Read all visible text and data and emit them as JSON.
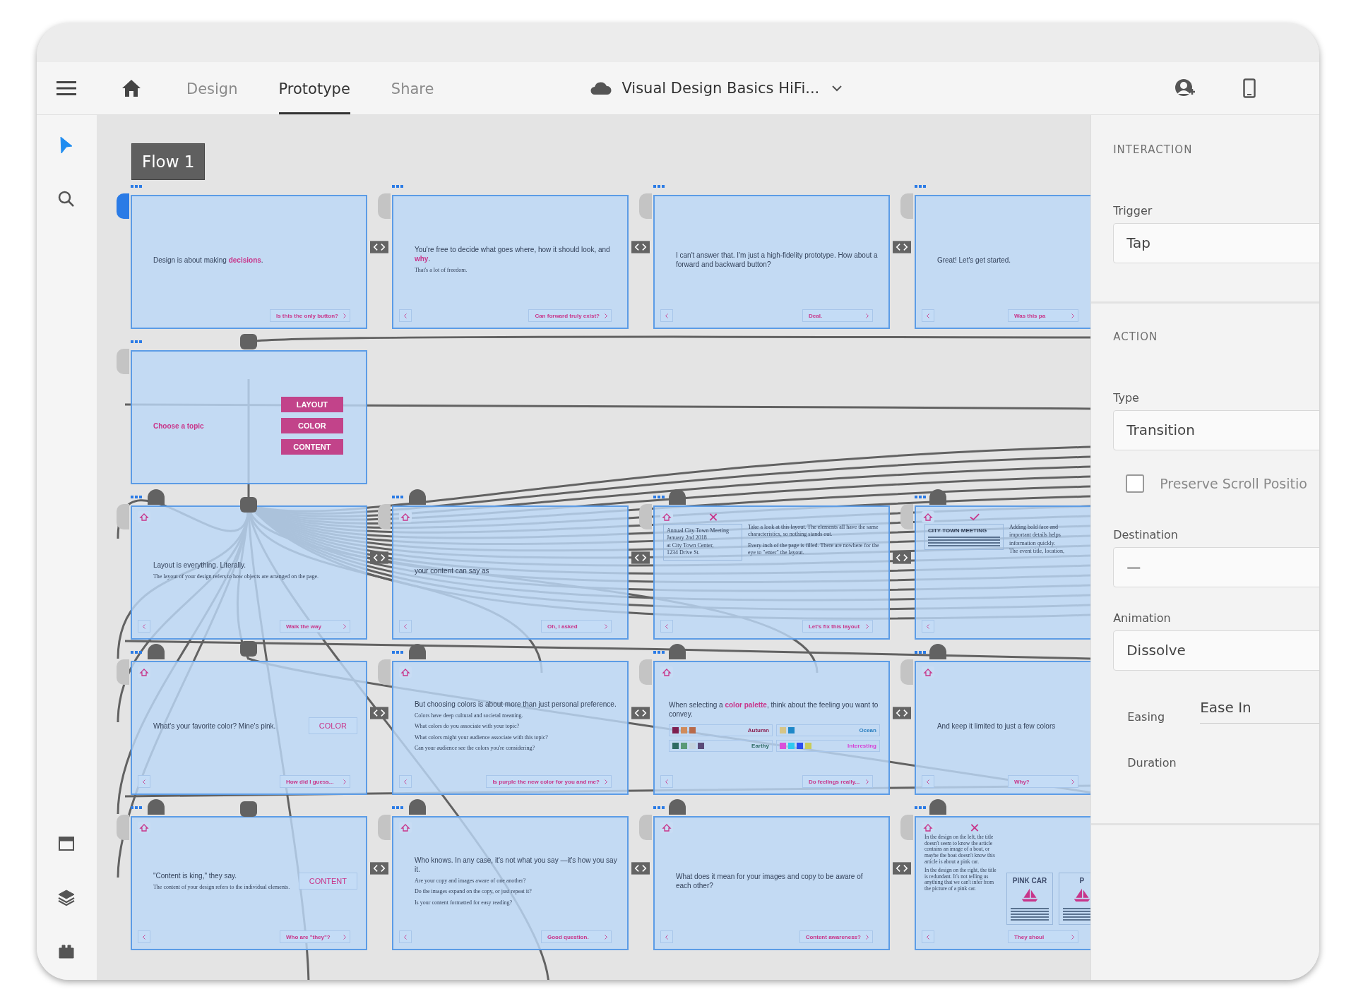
{
  "toolbar": {
    "tabs": [
      {
        "label": "Design",
        "selected": false
      },
      {
        "label": "Prototype",
        "selected": true
      },
      {
        "label": "Share",
        "selected": false
      }
    ],
    "document_title": "Visual Design Basics HiFi..."
  },
  "tools": [
    {
      "kind": "select",
      "selected": true
    },
    {
      "kind": "search",
      "selected": false
    }
  ],
  "flow_label": "Flow 1",
  "artboard_rows": [
    [
      {
        "kind": "text",
        "start": true,
        "home": false,
        "back": false,
        "title": "Design is about making **decisions**.",
        "next": "Is this the only button?"
      },
      {
        "kind": "text",
        "start": false,
        "home": false,
        "back": true,
        "title": "You're free to decide what goes where, how it should look, and **why**.",
        "body": [
          "That's a lot of freedom."
        ],
        "next": "Can forward truly exist?"
      },
      {
        "kind": "text",
        "start": false,
        "home": false,
        "back": true,
        "title": "I can't answer that. I'm just a high-fidelity prototype. How about a forward and backward button?",
        "next": "Deal."
      },
      {
        "kind": "text",
        "start": false,
        "home": false,
        "back": true,
        "title": "Great! Let's get started.",
        "next": "Was this pa"
      }
    ],
    [
      {
        "kind": "topics",
        "start": false,
        "home": false,
        "back": false,
        "title": "Choose a topic",
        "topics": [
          "LAYOUT",
          "COLOR",
          "CONTENT"
        ]
      }
    ],
    [
      {
        "kind": "text",
        "start": false,
        "home": true,
        "back": true,
        "title": "Layout is everything. Literally.",
        "body": [
          "The layout of your design refers to how objects are arranged on the page."
        ],
        "next": "Walk the way"
      },
      {
        "kind": "text",
        "start": false,
        "home": true,
        "back": true,
        "title": "your content can say as",
        "next": "Oh, I asked"
      },
      {
        "kind": "layout",
        "approved": false,
        "start": false,
        "home": true,
        "back": true,
        "doc": [
          "Annual City Town Meeting",
          "January 2nd 2018",
          "at City Town Center,",
          "1234 Drive St."
        ],
        "notes": [
          "Take a look at this layout. The elements all have the same characteristics, so nothing stands out.",
          "Every inch of the page is filled. There are nowhere for the eye to \"enter\" the layout."
        ],
        "next": "Let's fix this layout"
      },
      {
        "kind": "layout",
        "approved": true,
        "start": false,
        "home": true,
        "back": true,
        "doc": [
          "CITY TOWN MEETING"
        ],
        "notes": [
          "Adding bold face and",
          "important details helps",
          "information quickly.",
          "The event title, location,"
        ]
      }
    ],
    [
      {
        "kind": "text",
        "start": false,
        "home": true,
        "back": true,
        "title": "What's your favorite color? Mine's pink.",
        "tag": "COLOR",
        "next": "How did I guess..."
      },
      {
        "kind": "text",
        "start": false,
        "home": true,
        "back": true,
        "title": "But choosing colors is about more than just personal preference.",
        "body": [
          "Colors have deep cultural and societal meaning.",
          "What colors do you associate with your topic?",
          "What colors might your audience associate with this topic?",
          "Can your audience see the colors you're considering?"
        ],
        "next": "Is purple the new color for you and me?"
      },
      {
        "kind": "palettes",
        "start": false,
        "home": true,
        "back": true,
        "title": "When selecting a **color palette**, think about the feeling you want to convey.",
        "palettes": [
          {
            "name": "Autumn",
            "color": "#8a1d4e",
            "swatches": [
              {
                "color": "#7e1f4f"
              },
              {
                "color": "#d08b5b"
              },
              {
                "color": "#b86a4a"
              }
            ]
          },
          {
            "name": "Ocean",
            "color": "#2a7fc0",
            "swatches": [
              {
                "color": "#d6c587"
              },
              {
                "color": "#1e88c8"
              }
            ]
          },
          {
            "name": "Earthy",
            "color": "#2f6b63",
            "swatches": [
              {
                "color": "#2f6b63"
              },
              {
                "color": "#5a9a78"
              },
              {
                "color": "#c5d3de"
              },
              {
                "color": "#5a4a78"
              }
            ]
          },
          {
            "name": "Interesting",
            "color": "#d63fd6",
            "swatches": [
              {
                "color": "#d94fd9"
              },
              {
                "color": "#2ec8f0"
              },
              {
                "color": "#2a4ef0"
              },
              {
                "color": "#c8cc5a"
              }
            ]
          }
        ],
        "next": "Do feelings really..."
      },
      {
        "kind": "text",
        "start": false,
        "home": true,
        "back": true,
        "title": "And keep it limited to just a few colors",
        "next": "Why?"
      }
    ],
    [
      {
        "kind": "text",
        "start": false,
        "home": true,
        "back": true,
        "title": "\"Content is king,\" they say.",
        "body": [
          "The content of your design refers to the individual elements."
        ],
        "tag": "CONTENT",
        "next": "Who are \"they\"?"
      },
      {
        "kind": "text",
        "start": false,
        "home": true,
        "back": true,
        "title": "Who knows. In any case, it's not what you say —it's how you say it.",
        "body": [
          "Are your copy and images aware of one another?",
          "Do the images expand on the copy, or just repeat it?",
          "Is your content formatted for easy reading?"
        ],
        "next": "Good question."
      },
      {
        "kind": "text",
        "start": false,
        "home": true,
        "back": true,
        "title": "What does it mean for your images and copy to be aware of each other?",
        "next": "Content awareness?"
      },
      {
        "kind": "boat",
        "approved": false,
        "start": false,
        "home": true,
        "back": true,
        "notes": [
          "In the design on the left, the title doesn't seem to know the article contains an image of a boat, or maybe the boat doesn't know this article is about a pink car.",
          "In the design on the right, the title is redundant. It's not telling us anything that we can't infer from the picture of a pink car."
        ],
        "cards": [
          "PINK CAR",
          "P"
        ],
        "next": "They shoul"
      }
    ]
  ],
  "panel": {
    "interaction_heading": "INTERACTION",
    "trigger_label": "Trigger",
    "trigger_value": "Tap",
    "action_heading": "ACTION",
    "type_label": "Type",
    "type_value": "Transition",
    "preserve_scroll": {
      "label": "Preserve Scroll Positio",
      "checked": false
    },
    "destination_label": "Destination",
    "destination_value": "—",
    "animation_label": "Animation",
    "animation_value": "Dissolve",
    "easing_label": "Easing",
    "easing_value": "Ease In",
    "duration_label": "Duration"
  }
}
